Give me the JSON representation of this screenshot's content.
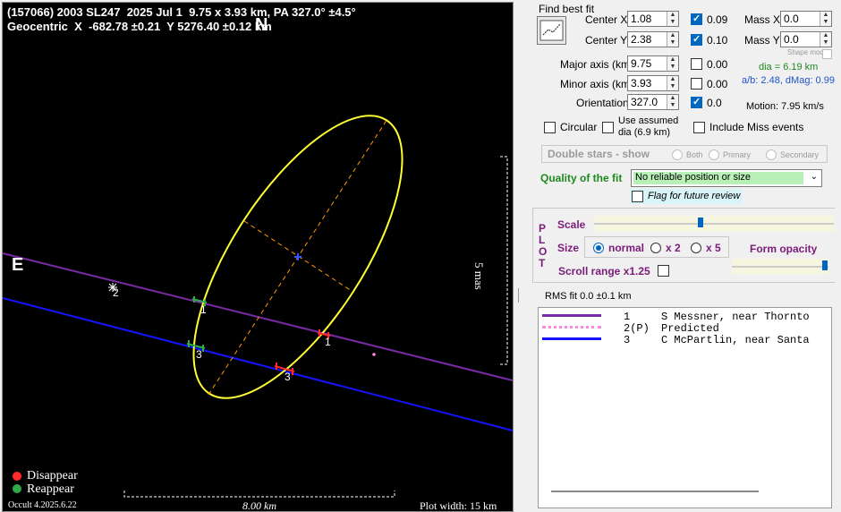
{
  "plot": {
    "header_line1": "(157066) 2003 SL247  2025 Jul 1  9.75 x 3.93 km, PA 327.0° ±4.5°",
    "header_line2": "Geocentric  X  -682.78 ±0.21  Y 5276.40 ±0.12 km",
    "north": "N",
    "east": "E",
    "scale_right": "5 mas",
    "scale_bottom": "8.00 km",
    "plot_width": "Plot width: 15 km",
    "version": "Occult 4.2025.6.22",
    "legend_disappear": "Disappear",
    "legend_reappear": "Reappear",
    "chord_labels": [
      "1",
      "2",
      "3",
      "1",
      "3",
      "1",
      "3"
    ],
    "colors": {
      "chord1": "#7a2aa8",
      "chord3": "#1414ff",
      "ellipse": "#ffff33",
      "disappear": "#ff2a2a",
      "reappear": "#2faa4a"
    }
  },
  "fit": {
    "title": "Find best fit",
    "center_x_label": "Center X",
    "center_x": "1.08",
    "center_x_unc": "0.09",
    "center_y_label": "Center Y",
    "center_y": "2.38",
    "center_y_unc": "0.10",
    "major_label": "Major axis (km)",
    "major": "9.75",
    "major_unc": "0.00",
    "minor_label": "Minor axis (km)",
    "minor": "3.93",
    "minor_unc": "0.00",
    "orient_label": "Orientation",
    "orient": "327.0",
    "orient_unc": "0.0",
    "mass_x_label": "Mass X",
    "mass_x": "0.0",
    "mass_y_label": "Mass Y",
    "mass_y": "0.0",
    "shape_model": "Shape model",
    "dia": "dia = 6.19 km",
    "ab": "a/b: 2.48, dMag: 0.99",
    "motion": "Motion: 7.95 km/s",
    "circular": "Circular",
    "use_assumed": "Use assumed",
    "use_assumed2": "dia (6.9 km)",
    "include_miss": "Include Miss events",
    "double_stars": "Double stars - show",
    "both": "Both",
    "primary": "Primary",
    "secondary": "Secondary",
    "quality_label": "Quality of the fit",
    "quality_value": "No reliable position or size",
    "flag_review": "Flag for future review"
  },
  "plotctl": {
    "vertical": [
      "P",
      "L",
      "O",
      "T"
    ],
    "scale": "Scale",
    "size": "Size",
    "normal": "normal",
    "x2": "x 2",
    "x5": "x 5",
    "form_opacity": "Form opacity",
    "scroll_range": "Scroll range x1.25",
    "rms": "RMS fit 0.0 ±0.1 km"
  },
  "observers": [
    {
      "num": "1",
      "name": "S Messner, near Thornto",
      "color": "#7a2aa8"
    },
    {
      "num": "2(P)",
      "name": "Predicted",
      "color": "#ff88dd"
    },
    {
      "num": "3",
      "name": "C McPartlin, near Santa",
      "color": "#1414ff"
    }
  ]
}
